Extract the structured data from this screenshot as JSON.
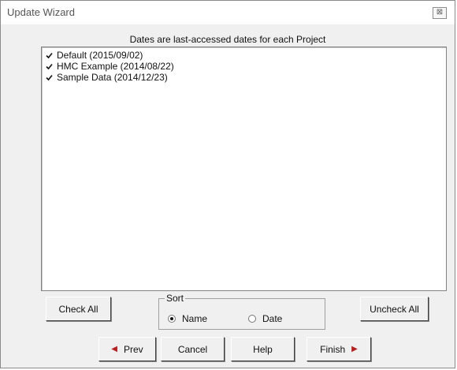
{
  "window": {
    "title": "Update Wizard",
    "close_glyph": "⊠"
  },
  "caption": "Dates are last-accessed dates for each Project",
  "projects": [
    {
      "label": "Default (2015/09/02)",
      "checked": true
    },
    {
      "label": "HMC Example (2014/08/22)",
      "checked": true
    },
    {
      "label": "Sample Data (2014/12/23)",
      "checked": true
    }
  ],
  "buttons": {
    "check_all": "Check All",
    "uncheck_all": "Uncheck All",
    "prev": "Prev",
    "cancel": "Cancel",
    "help": "Help",
    "finish": "Finish"
  },
  "sort": {
    "label": "Sort",
    "options": [
      {
        "label": "Name",
        "selected": true
      },
      {
        "label": "Date",
        "selected": false
      }
    ]
  },
  "icons": {
    "prev": "arrow-left-icon",
    "finish": "arrow-right-icon",
    "check": "check-icon"
  },
  "colors": {
    "arrow": "#b22020",
    "background": "#f0f0f0"
  }
}
